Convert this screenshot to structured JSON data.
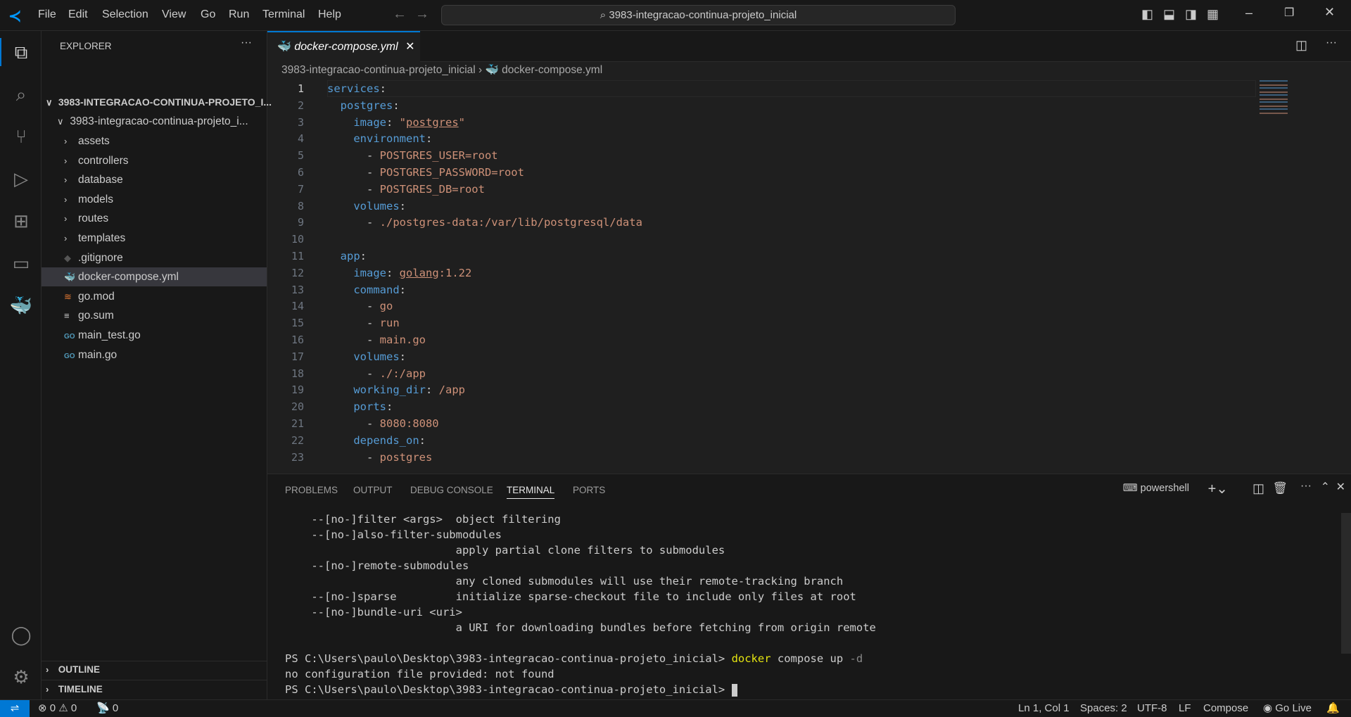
{
  "menu": [
    "File",
    "Edit",
    "Selection",
    "View",
    "Go",
    "Run",
    "Terminal",
    "Help"
  ],
  "search": "3983-integracao-continua-projeto_inicial",
  "explorer": {
    "title": "EXPLORER",
    "root": "3983-INTEGRACAO-CONTINUA-PROJETO_I...",
    "folder": "3983-integracao-continua-projeto_i...",
    "items": [
      {
        "label": "assets",
        "type": "folder"
      },
      {
        "label": "controllers",
        "type": "folder"
      },
      {
        "label": "database",
        "type": "folder"
      },
      {
        "label": "models",
        "type": "folder"
      },
      {
        "label": "routes",
        "type": "folder"
      },
      {
        "label": "templates",
        "type": "folder"
      },
      {
        "label": ".gitignore",
        "type": "git"
      },
      {
        "label": "docker-compose.yml",
        "type": "docker",
        "selected": true
      },
      {
        "label": "go.mod",
        "type": "gomod"
      },
      {
        "label": "go.sum",
        "type": "list"
      },
      {
        "label": "main_test.go",
        "type": "go"
      },
      {
        "label": "main.go",
        "type": "go"
      }
    ],
    "outline": "OUTLINE",
    "timeline": "TIMELINE"
  },
  "tab": {
    "label": "docker-compose.yml"
  },
  "breadcrumb": {
    "folder": "3983-integracao-continua-projeto_inicial",
    "file": "docker-compose.yml"
  },
  "code": [
    [
      [
        "k",
        "services"
      ],
      [
        "p",
        ":"
      ]
    ],
    [
      [
        "p",
        "  "
      ],
      [
        "k",
        "postgres"
      ],
      [
        "p",
        ":"
      ]
    ],
    [
      [
        "p",
        "    "
      ],
      [
        "k",
        "image"
      ],
      [
        "p",
        ": "
      ],
      [
        "s",
        "\""
      ],
      [
        "su",
        "postgres"
      ],
      [
        "s",
        "\""
      ]
    ],
    [
      [
        "p",
        "    "
      ],
      [
        "k",
        "environment"
      ],
      [
        "p",
        ":"
      ]
    ],
    [
      [
        "p",
        "      - "
      ],
      [
        "s",
        "POSTGRES_USER=root"
      ]
    ],
    [
      [
        "p",
        "      - "
      ],
      [
        "s",
        "POSTGRES_PASSWORD=root"
      ]
    ],
    [
      [
        "p",
        "      - "
      ],
      [
        "s",
        "POSTGRES_DB=root"
      ]
    ],
    [
      [
        "p",
        "    "
      ],
      [
        "k",
        "volumes"
      ],
      [
        "p",
        ":"
      ]
    ],
    [
      [
        "p",
        "      - "
      ],
      [
        "s",
        "./postgres-data:/var/lib/postgresql/data"
      ]
    ],
    [],
    [
      [
        "p",
        "  "
      ],
      [
        "k",
        "app"
      ],
      [
        "p",
        ":"
      ]
    ],
    [
      [
        "p",
        "    "
      ],
      [
        "k",
        "image"
      ],
      [
        "p",
        ": "
      ],
      [
        "su",
        "golang"
      ],
      [
        "s",
        ":1.22"
      ]
    ],
    [
      [
        "p",
        "    "
      ],
      [
        "k",
        "command"
      ],
      [
        "p",
        ":"
      ]
    ],
    [
      [
        "p",
        "      - "
      ],
      [
        "s",
        "go"
      ]
    ],
    [
      [
        "p",
        "      - "
      ],
      [
        "s",
        "run"
      ]
    ],
    [
      [
        "p",
        "      - "
      ],
      [
        "s",
        "main.go"
      ]
    ],
    [
      [
        "p",
        "    "
      ],
      [
        "k",
        "volumes"
      ],
      [
        "p",
        ":"
      ]
    ],
    [
      [
        "p",
        "      - "
      ],
      [
        "s",
        "./:/app"
      ]
    ],
    [
      [
        "p",
        "    "
      ],
      [
        "k",
        "working_dir"
      ],
      [
        "p",
        ": "
      ],
      [
        "s",
        "/app"
      ]
    ],
    [
      [
        "p",
        "    "
      ],
      [
        "k",
        "ports"
      ],
      [
        "p",
        ":"
      ]
    ],
    [
      [
        "p",
        "      - "
      ],
      [
        "s",
        "8080:8080"
      ]
    ],
    [
      [
        "p",
        "    "
      ],
      [
        "k",
        "depends_on"
      ],
      [
        "p",
        ":"
      ]
    ],
    [
      [
        "p",
        "      - "
      ],
      [
        "s",
        "postgres"
      ]
    ]
  ],
  "panel": {
    "tabs": [
      "PROBLEMS",
      "OUTPUT",
      "DEBUG CONSOLE",
      "TERMINAL",
      "PORTS"
    ],
    "active": "TERMINAL",
    "shell": "powershell"
  },
  "terminal": {
    "lines": [
      "    --[no-]filter <args>  object filtering",
      "    --[no-]also-filter-submodules",
      "                          apply partial clone filters to submodules",
      "    --[no-]remote-submodules",
      "                          any cloned submodules will use their remote-tracking branch",
      "    --[no-]sparse         initialize sparse-checkout file to include only files at root",
      "    --[no-]bundle-uri <uri>",
      "                          a URI for downloading bundles before fetching from origin remote",
      ""
    ],
    "prompt": "PS C:\\Users\\paulo\\Desktop\\3983-integracao-continua-projeto_inicial> ",
    "cmd": "docker",
    "args": " compose up",
    "flag": " -d",
    "error": "no configuration file provided: not found"
  },
  "status": {
    "errors": "0",
    "warnings": "0",
    "ports": "0",
    "position": "Ln 1, Col 1",
    "spaces": "Spaces: 2",
    "encoding": "UTF-8",
    "eol": "LF",
    "language": "Compose",
    "golive": "Go Live"
  }
}
